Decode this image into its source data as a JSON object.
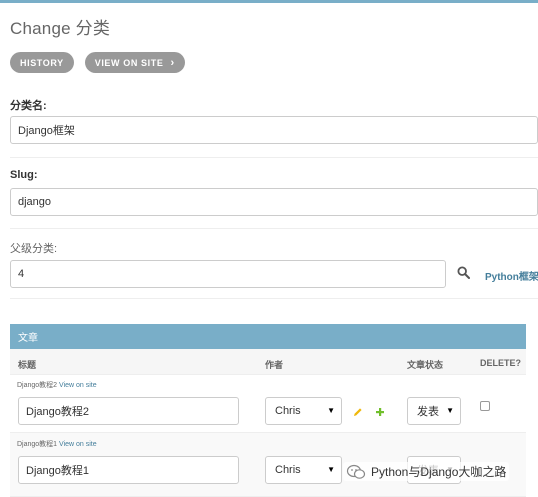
{
  "page": {
    "title": "Change 分类"
  },
  "object_tools": {
    "history_label": "HISTORY",
    "view_on_site_label": "VIEW ON SITE"
  },
  "fields": {
    "name": {
      "label": "分类名:",
      "value": "Django框架"
    },
    "slug": {
      "label": "Slug:",
      "value": "django"
    },
    "parent": {
      "label": "父级分类:",
      "value": "4",
      "lookup_text": "Python框架"
    }
  },
  "inline": {
    "title": "文章",
    "columns": {
      "title": "标题",
      "author": "作者",
      "status": "文章状态",
      "delete": "DELETE?"
    },
    "rows": [
      {
        "original": "Django教程2",
        "view_on_site": "View on site",
        "title_value": "Django教程2",
        "author": "Chris",
        "status": "发表"
      },
      {
        "original": "Django教程1",
        "view_on_site": "View on site",
        "title_value": "Django教程1",
        "author": "Chris",
        "status": "发表"
      }
    ]
  },
  "watermark": {
    "text": "Python与Django大咖之路"
  },
  "colors": {
    "header_blue": "#79aec8",
    "link_blue": "#447e9b",
    "pill_gray": "#999999",
    "pencil_yellow": "#efb80b",
    "plus_green": "#70bf2b"
  }
}
